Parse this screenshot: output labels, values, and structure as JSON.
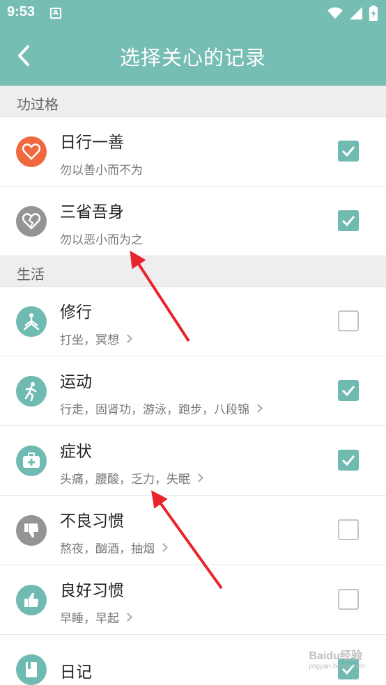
{
  "status_bar": {
    "time": "9:53",
    "notification_icon": "A"
  },
  "header": {
    "title": "选择关心的记录",
    "back_icon": "chevron-left-icon"
  },
  "sections": [
    {
      "label": "功过格"
    },
    {
      "label": "生活"
    }
  ],
  "items": [
    {
      "name": "日行一善",
      "sub": "勿以善小而不为",
      "checked": true,
      "icon": "heart-icon",
      "color": "#f0683e"
    },
    {
      "name": "三省吾身",
      "sub": "勿以恶小而为之",
      "checked": true,
      "icon": "broken-heart-icon",
      "color": "#949494"
    },
    {
      "name": "修行",
      "sub": "打坐，冥想",
      "checked": false,
      "icon": "meditation-icon",
      "color": "#6fbbb2"
    },
    {
      "name": "运动",
      "sub": "行走，固肾功，游泳，跑步，八段锦",
      "checked": true,
      "icon": "running-icon",
      "color": "#6fbbb2"
    },
    {
      "name": "症状",
      "sub": "头痛，腰酸，乏力，失眠",
      "checked": true,
      "icon": "medical-kit-icon",
      "color": "#6fbbb2"
    },
    {
      "name": "不良习惯",
      "sub": "熬夜，酗酒，抽烟",
      "checked": false,
      "icon": "thumbs-down-icon",
      "color": "#949494"
    },
    {
      "name": "良好习惯",
      "sub": "早睡，早起",
      "checked": false,
      "icon": "thumbs-up-icon",
      "color": "#6fbbb2"
    },
    {
      "name": "日记",
      "checked": true,
      "icon": "diary-icon",
      "color": "#6fbbb2"
    }
  ],
  "watermark": {
    "text": "Baidu经验",
    "small": "jingyan.baidu.com"
  },
  "colors": {
    "accent": "#76bdb3",
    "checkbox": "#6fbbb2",
    "arrow": "#e8232b"
  }
}
